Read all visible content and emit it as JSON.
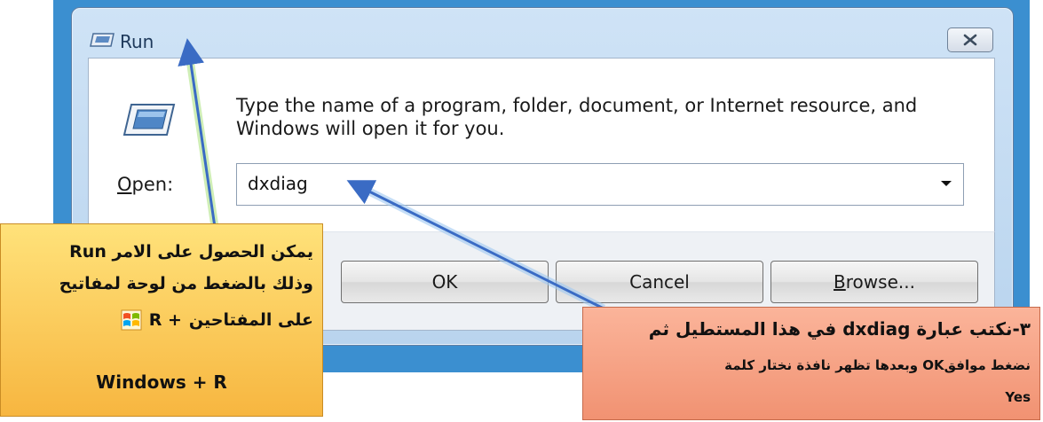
{
  "window": {
    "title": "Run",
    "description": "Type the name of a program, folder, document, or Internet resource, and Windows will open it for you.",
    "open_label_accel": "O",
    "open_label_rest": "pen:",
    "open_value": "dxdiag",
    "ok_label": "OK",
    "cancel_label": "Cancel",
    "browse_label_accel": "B",
    "browse_label_rest": "rowse..."
  },
  "annotations": {
    "left": {
      "line1": "يمكن الحصول على الامر  Run",
      "line2": "وذلك بالضغط من لوحة لمفاتيح",
      "line3": "على المفتاحين",
      "line3_keys": "R  +",
      "line4": "Windows + R"
    },
    "right": {
      "line1": "٣-نكتب عبارة dxdiag في هذا المستطيل ثم",
      "line2": "نضغط موافقOK وبعدها تظهر نافذة نختار كلمة",
      "line3": "Yes"
    }
  },
  "colors": {
    "desktop": "#3b8fd0",
    "note_left": "#f7b640",
    "note_right": "#f19272",
    "arrow": "#3a6bc4"
  }
}
